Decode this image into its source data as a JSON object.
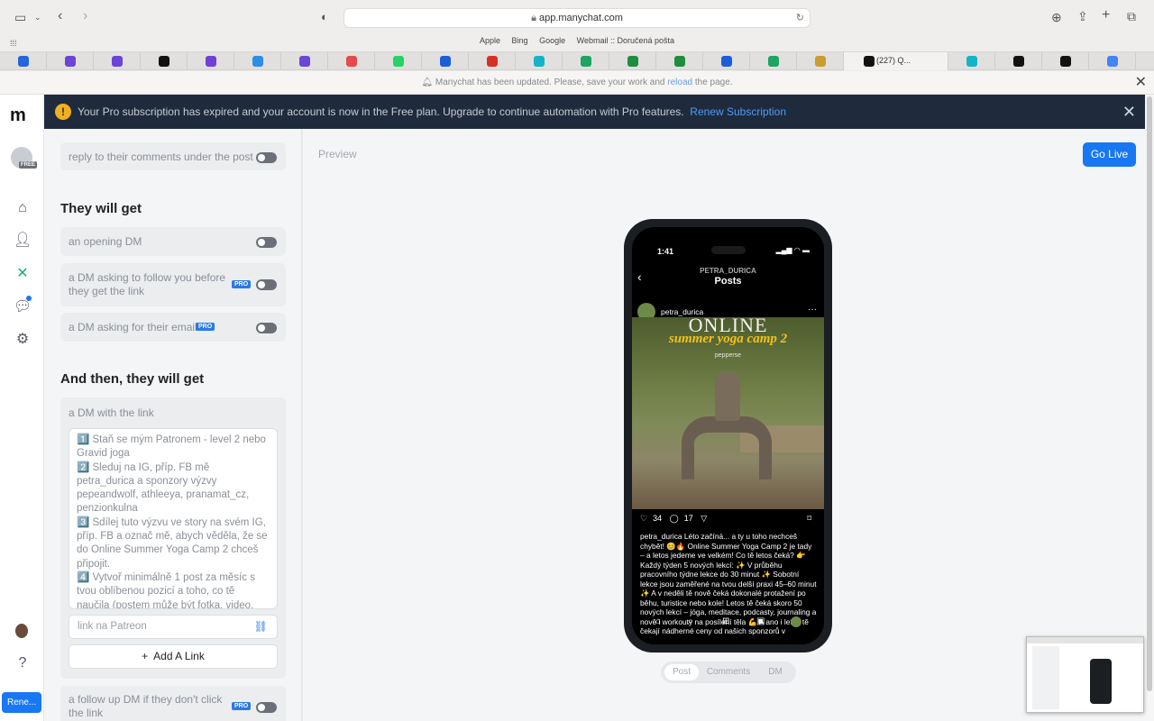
{
  "browser": {
    "url": "app.manychat.com",
    "favorites": [
      "Apple",
      "Bing",
      "Google",
      "Webmail :: Doručená pošta"
    ],
    "active_tab_title": "(227) Q...",
    "notice_text": "Manychat has been updated. Please, save your work and ",
    "notice_link": "reload",
    "notice_tail": " the page."
  },
  "tab_favicon_colors": [
    "#2466d9",
    "#6a45d8",
    "#6a45d8",
    "#111111",
    "#7040d8",
    "#2d8ee8",
    "#6a45d8",
    "#e64a4a",
    "#25d366",
    "#1a5ed8",
    "#d93025",
    "#14b4c8",
    "#1fa463",
    "#1e8e3e",
    "#1e8e3e",
    "#1a5ed8",
    "#1fa463",
    "#c99d2e",
    "#111111",
    "#14b4c8",
    "#111111",
    "#111111",
    "#4285f4",
    "#14b4c8"
  ],
  "banner": {
    "text": "Your Pro subscription has expired and your account is now in the Free plan. Upgrade to continue automation with Pro features.",
    "link": "Renew Subscription"
  },
  "sidebar": {
    "free_badge": "FREE",
    "renew_button": "Rene..."
  },
  "panel": {
    "top_option": "reply to their comments under the post",
    "they_will_get": "They will get",
    "options": [
      {
        "label": "an opening DM",
        "pro": false,
        "on": false
      },
      {
        "label": "a DM asking to follow you before they get the link",
        "pro": true,
        "on": false
      },
      {
        "label": "a DM asking for their email",
        "pro": true,
        "on": false
      }
    ],
    "pro_label": "PRO",
    "and_then": "And then, they will get",
    "dm_link_label": "a DM with the link",
    "message": "1️⃣ Staň se mým Patronem - level 2 nebo Gravid joga\n2️⃣ Sleduj na IG, příp. FB mě petra_durica a sponzory výzvy pepeandwolf, athleeya, pranamat_cz, penzionkulna\n3️⃣ Sdílej tuto výzvu ve story na svém IG, příp. FB a označ mě, abych věděla, že se do Online Summer Yoga Camp 2 chceš připojit.\n4️⃣ Vytvoř minimálně 1 post za měsíc s tvou oblíbenou pozicí a toho, co tě naučila (postem může být fotka, video, reel), v postu mě nezapomeň označit",
    "link_placeholder": "link na Patreon",
    "add_link": "Add A Link",
    "follow_up": "a follow up DM if they don't click the link"
  },
  "main": {
    "preview_label": "Preview",
    "go_live": "Go Live",
    "tabs": [
      "Post",
      "Comments",
      "DM"
    ]
  },
  "phone": {
    "time": "1:41",
    "username_header": "PETRA_DURICA",
    "posts_title": "Posts",
    "post_user": "petra_durica",
    "photo_title": "ONLINE",
    "photo_script": "summer yoga camp 2",
    "photo_small": "pepperse",
    "likes": "34",
    "comments": "17",
    "caption": "petra_durica Léto začíná... a ty u toho nechceš chybět! 😊🔥 Online Summer Yoga Camp 2 je tady – a letos jedeme ve velkém! Co tě letos čeká? 👉 Každý týden 5 nových lekcí: ✨ V průběhu pracovního týdne lekce do 30 minut ✨ Sobotní lekce jsou zaměřené na tvou delší praxi 45–60 minut ✨ A v neděli tě nově čeká dokonalé protažení po běhu, turistice nebo kole! Letos tě čeká skoro 50 nových lekcí – jóga, meditace, podcasty, journaling a nově i workouty na posílení těla 💪 A ano i letos tě čekají nádherné ceny od našich sponzorů v"
  }
}
